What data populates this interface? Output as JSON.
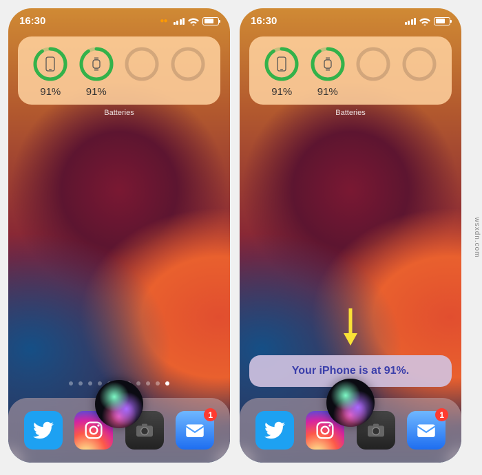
{
  "status": {
    "time": "16:30"
  },
  "widget": {
    "label": "Batteries",
    "devices": [
      {
        "name": "iPhone",
        "percent": "91%"
      },
      {
        "name": "Apple Watch",
        "percent": "91%"
      }
    ]
  },
  "page_indicator": {
    "count": 11,
    "active_index": 10
  },
  "dock": {
    "apps": [
      {
        "name": "Twitter"
      },
      {
        "name": "Instagram"
      },
      {
        "name": "Camera"
      },
      {
        "name": "Mail",
        "badge": "1"
      }
    ]
  },
  "siri_response": {
    "text": "Your iPhone is at 91%."
  },
  "colors": {
    "siri_text": "#3a3eaa",
    "green_ring": "#33b24a",
    "arrow": "#f9e137"
  },
  "watermark": "wsxdn.com"
}
